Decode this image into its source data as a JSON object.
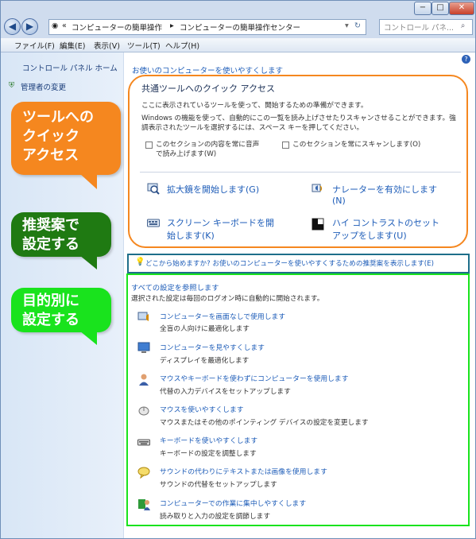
{
  "titlebar": {
    "minimize": "−",
    "maximize": "□",
    "close": "✕"
  },
  "address": {
    "back": "◀",
    "forward": "▶",
    "overflow": "«",
    "crumb1": "コンピューターの簡単操作",
    "sep1": "▸",
    "crumb2": "コンピューターの簡単操作センター",
    "sep2": "▸",
    "refresh": "↻",
    "search_placeholder": "コントロール パネ..."
  },
  "menu": [
    {
      "label": "ファイル(F)"
    },
    {
      "label": "編集(E)"
    },
    {
      "label": "表示(V)"
    },
    {
      "label": "ツール(T)"
    },
    {
      "label": "ヘルプ(H)"
    }
  ],
  "sidebar": {
    "home": "コントロール パネル ホーム",
    "admin": "管理者の変更"
  },
  "help_icon": "?",
  "main": {
    "intro_link": "お使いのコンピューターを使いやすくします",
    "quick": {
      "title": "共通ツールへのクイック アクセス",
      "desc1": "ここに表示されているツールを使って、開始するための準備ができます。",
      "desc2": "Windows の機能を使って、自動的にこの一覧を読み上げさせたりスキャンさせることができます。強",
      "desc3": "調表示されたツールを選択するには、スペース キーを押してください。",
      "cb1_line1": "このセクションの内容を常に音声",
      "cb1_line2": "で読み上げます(W)",
      "cb2": "このセクションを常にスキャンします(O)",
      "tool_magnifier": "拡大鏡を開始します(G)",
      "tool_narrator_line1": "ナレーターを有効にします",
      "tool_narrator_line2": "(N)",
      "tool_osk_line1": "スクリーン キーボードを開",
      "tool_osk_line2": "始します(K)",
      "tool_contrast_line1": "ハイ コントラストのセット",
      "tool_contrast_line2": "アップをします(U)"
    },
    "recommend": "どこから始めますか? お使いのコンピューターを使いやすくするための推奨案を表示します(E)",
    "all": {
      "title": "すべての設定を参照します",
      "subtitle": "選択された設定は毎回のログオン時に自動的に開始されます。",
      "items": [
        {
          "link": "コンピューターを画面なしで使用します",
          "desc": "全盲の人向けに最適化します"
        },
        {
          "link": "コンピューターを見やすくします",
          "desc": "ディスプレイを最適化します"
        },
        {
          "link": "マウスやキーボードを使わずにコンピューターを使用します",
          "desc": "代替の入力デバイスをセットアップします"
        },
        {
          "link": "マウスを使いやすくします",
          "desc": "マウスまたはその他のポインティング デバイスの設定を変更します"
        },
        {
          "link": "キーボードを使いやすくします",
          "desc": "キーボードの設定を調整します"
        },
        {
          "link": "サウンドの代わりにテキストまたは画像を使用します",
          "desc": "サウンドの代替をセットアップします"
        },
        {
          "link": "コンピューターでの作業に集中しやすくします",
          "desc": "読み取りと入力の設定を調節します"
        }
      ]
    }
  },
  "callouts": {
    "orange": [
      "ツールへの",
      "クイック",
      "アクセス"
    ],
    "green": [
      "推奨案で",
      "設定する"
    ],
    "lime": [
      "目的別に",
      "設定する"
    ]
  },
  "colors": {
    "orange": "#f5871f",
    "green": "#1f7a12",
    "lime": "#19e31d",
    "teal": "#1e6e8a"
  }
}
